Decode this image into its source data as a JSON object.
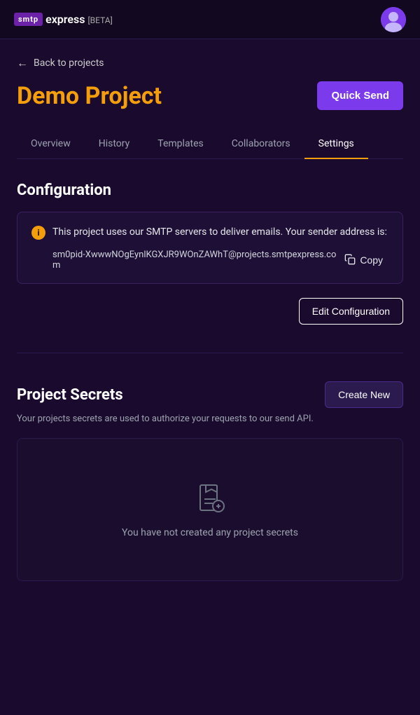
{
  "nav": {
    "smtp_label": "smtp",
    "express_label": "express",
    "beta_label": "[BETA]"
  },
  "breadcrumb": {
    "back_label": "Back to projects"
  },
  "project": {
    "title": "Demo Project",
    "quick_send_label": "Quick Send"
  },
  "tabs": [
    {
      "id": "overview",
      "label": "Overview",
      "active": false
    },
    {
      "id": "history",
      "label": "History",
      "active": false
    },
    {
      "id": "templates",
      "label": "Templates",
      "active": false
    },
    {
      "id": "collaborators",
      "label": "Collaborators",
      "active": false
    },
    {
      "id": "settings",
      "label": "Settings",
      "active": true
    }
  ],
  "configuration": {
    "section_title": "Configuration",
    "info_text": "This project uses our SMTP servers to deliver emails. Your sender address is:",
    "email": "sm0pid-XwwwNOgEynlKGXJR9WOnZAWhT@projects.smtpexpress.com",
    "copy_label": "Copy",
    "edit_config_label": "Edit Configuration"
  },
  "secrets": {
    "section_title": "Project Secrets",
    "description": "Your projects secrets are used to authorize your requests to our send API.",
    "create_new_label": "Create New",
    "empty_text": "You have not created any project secrets"
  }
}
